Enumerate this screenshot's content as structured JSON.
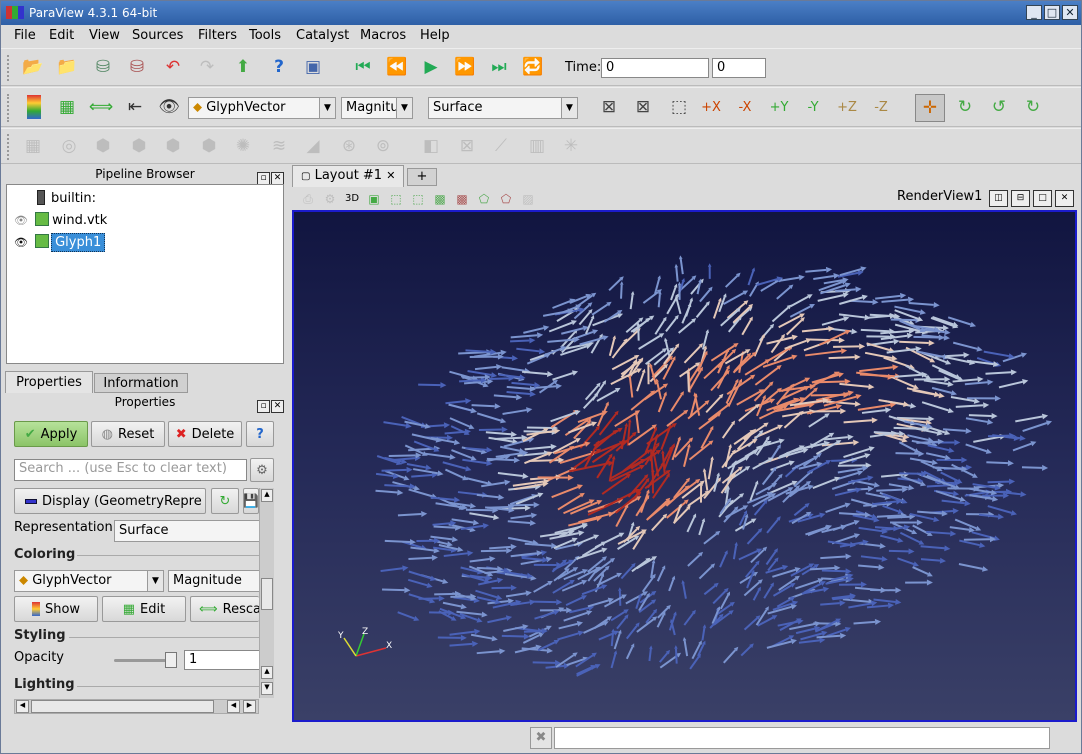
{
  "app": {
    "title": "ParaView 4.3.1 64-bit"
  },
  "menu": [
    "File",
    "Edit",
    "View",
    "Sources",
    "Filters",
    "Tools",
    "Catalyst",
    "Macros",
    "Help"
  ],
  "time": {
    "label": "Time:",
    "value": "0",
    "step": "0"
  },
  "toolbar2": {
    "color_array": "GlyphVector",
    "component": "Magnitu",
    "representation": "Surface"
  },
  "pipeline": {
    "title": "Pipeline Browser",
    "items": [
      {
        "label": "builtin:"
      },
      {
        "label": "wind.vtk"
      },
      {
        "label": "Glyph1"
      }
    ]
  },
  "tabs": {
    "properties": "Properties",
    "information": "Information"
  },
  "properties": {
    "title": "Properties",
    "apply": "Apply",
    "reset": "Reset",
    "delete": "Delete",
    "help": "?",
    "search_placeholder": "Search ... (use Esc to clear text)",
    "display": "Display (GeometryRepre",
    "representation_label": "Representation",
    "representation_value": "Surface",
    "coloring_header": "Coloring",
    "coloring_array": "GlyphVector",
    "coloring_component": "Magnitude",
    "show": "Show",
    "edit": "Edit",
    "rescale": "Rescal",
    "styling_header": "Styling",
    "opacity_label": "Opacity",
    "opacity_value": "1",
    "lighting_header": "Lighting"
  },
  "layout": {
    "tab": "Layout #1",
    "add": "+"
  },
  "view": {
    "name": "RenderView1",
    "toolbar_3d": "3D"
  },
  "colors": {
    "selection": "#3a8fd9",
    "view_border": "#1b1bcc",
    "apply_bg": "#9fd07a"
  }
}
